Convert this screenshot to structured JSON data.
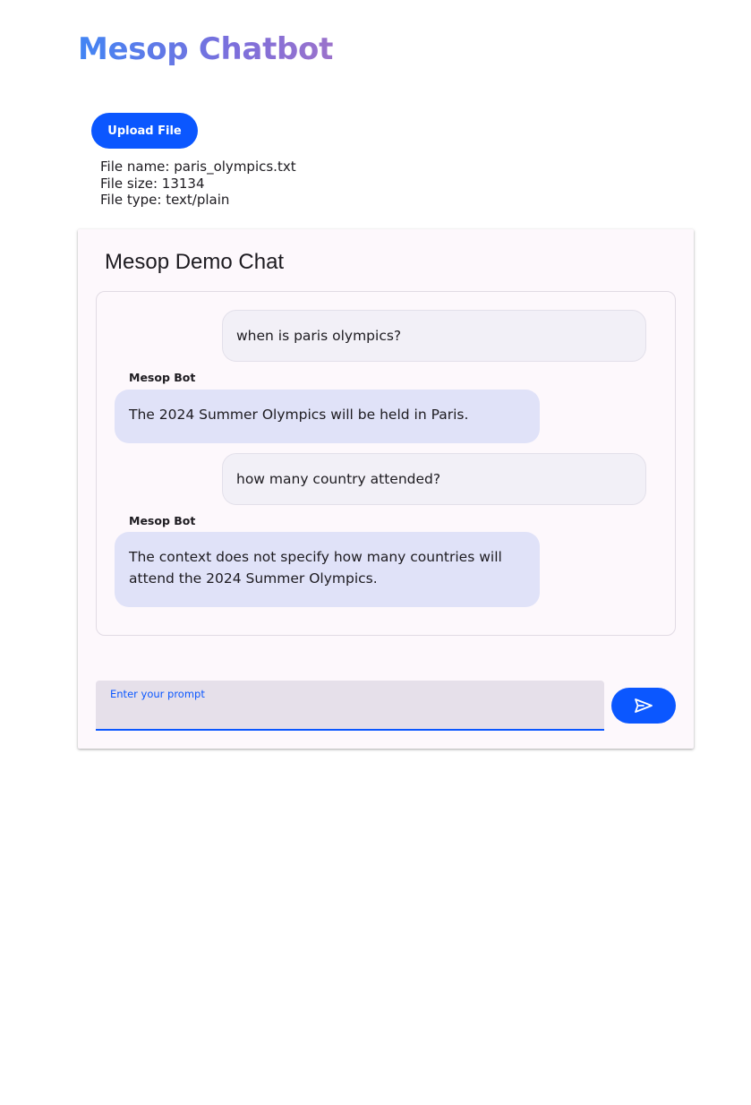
{
  "app": {
    "title": "Mesop Chatbot"
  },
  "upload": {
    "button_label": "Upload File",
    "file_name": "File name: paris_olympics.txt",
    "file_size": "File size: 13134",
    "file_type": "File type: text/plain"
  },
  "chat": {
    "title": "Mesop Demo Chat",
    "bot_name": "Mesop Bot",
    "messages": [
      {
        "role": "user",
        "content": "when is paris olympics?"
      },
      {
        "role": "bot",
        "name": "Mesop Bot",
        "content": "The 2024 Summer Olympics will be held in Paris."
      },
      {
        "role": "user",
        "content": "how many country attended?"
      },
      {
        "role": "bot",
        "name": "Mesop Bot",
        "content": "The context does not specify how many countries will attend the 2024 Summer Olympics."
      }
    ]
  },
  "input": {
    "label": "Enter your prompt",
    "value": ""
  },
  "icons": {
    "send": "send-icon"
  },
  "colors": {
    "accent": "#0b57ff",
    "title_gradient_start": "#4285f4",
    "title_gradient_end": "#9b72cb",
    "user_bubble": "#f2f0f7",
    "bot_bubble": "#e0e2f8",
    "card_background": "#fdf8fc",
    "input_background": "#e6e0ea"
  }
}
